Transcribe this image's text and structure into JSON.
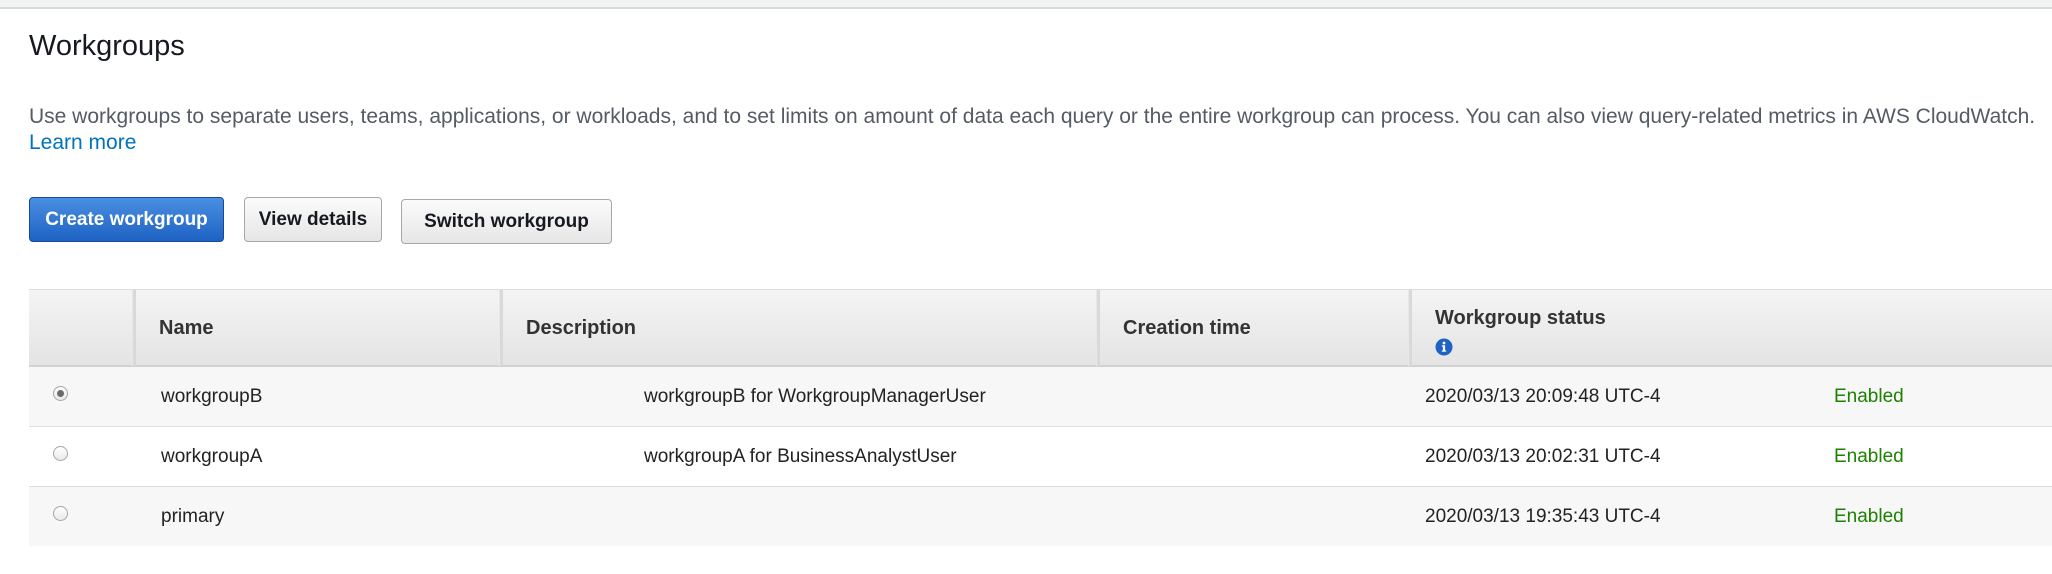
{
  "page": {
    "title": "Workgroups",
    "intro": "Use workgroups to separate users, teams, applications, or workloads, and to set limits on amount of data each query or the entire workgroup can process. You can also view query-related metrics in AWS CloudWatch.",
    "learn_more": "Learn more"
  },
  "toolbar": {
    "create_label": "Create workgroup",
    "view_label": "View details",
    "switch_label": "Switch workgroup"
  },
  "table": {
    "columns": {
      "name": "Name",
      "description": "Description",
      "creation_time": "Creation time",
      "status": "Workgroup status"
    },
    "status_info_icon": "info-icon",
    "rows": [
      {
        "selected": true,
        "name": "workgroupB",
        "description": "workgroupB for WorkgroupManagerUser",
        "creation_time": "2020/03/13 20:09:48 UTC-4",
        "status": "Enabled"
      },
      {
        "selected": false,
        "name": "workgroupA",
        "description": "workgroupA for BusinessAnalystUser",
        "creation_time": "2020/03/13 20:02:31 UTC-4",
        "status": "Enabled"
      },
      {
        "selected": false,
        "name": "primary",
        "description": "",
        "creation_time": "2020/03/13 19:35:43 UTC-4",
        "status": "Enabled"
      }
    ]
  },
  "colors": {
    "primary_button": "#1f62c4",
    "link": "#0073bb",
    "status_enabled": "#1d8102"
  }
}
